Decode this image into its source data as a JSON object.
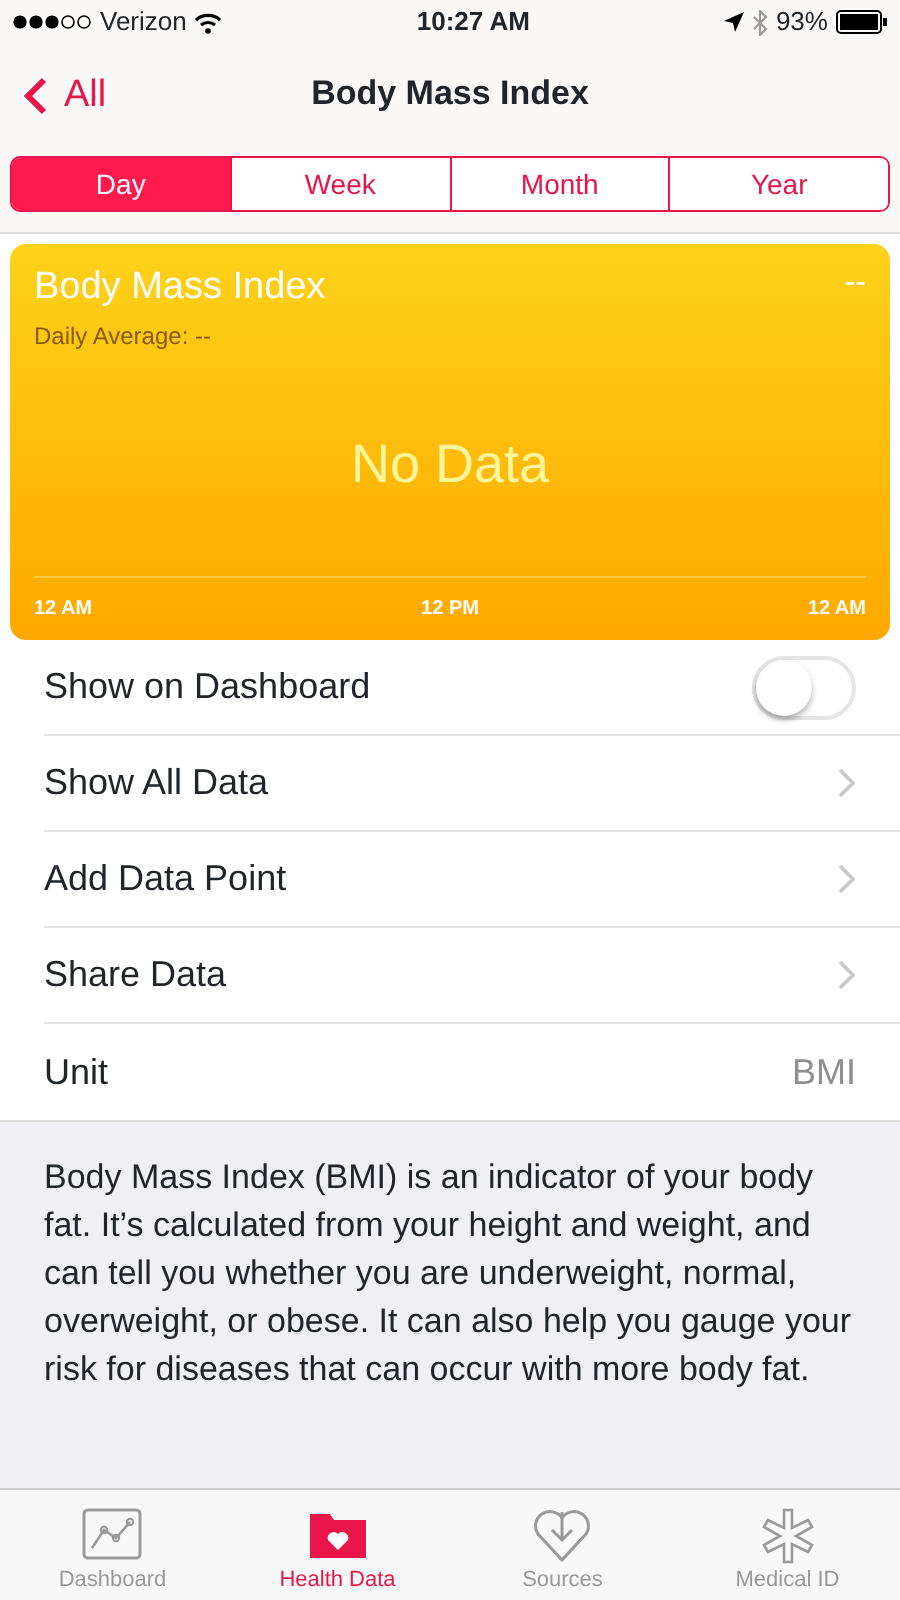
{
  "status_bar": {
    "carrier": "Verizon",
    "time": "10:27 AM",
    "battery": "93%"
  },
  "nav": {
    "back": "All",
    "title": "Body Mass Index"
  },
  "segments": [
    {
      "label": "Day",
      "selected": true
    },
    {
      "label": "Week",
      "selected": false
    },
    {
      "label": "Month",
      "selected": false
    },
    {
      "label": "Year",
      "selected": false
    }
  ],
  "card": {
    "title": "Body Mass Index",
    "value": "--",
    "subtitle": "Daily Average: --",
    "message": "No Data",
    "axis": [
      "12 AM",
      "12 PM",
      "12 AM"
    ]
  },
  "rows": [
    {
      "kind": "toggle",
      "label": "Show on Dashboard",
      "on": false
    },
    {
      "kind": "link",
      "label": "Show All Data"
    },
    {
      "kind": "link",
      "label": "Add Data Point"
    },
    {
      "kind": "link",
      "label": "Share Data"
    },
    {
      "kind": "value",
      "label": "Unit",
      "value": "BMI"
    }
  ],
  "description": "Body Mass Index (BMI) is an indicator of your body fat. It’s calculated from your height and weight, and can tell you whether you are underweight, normal, overweight, or obese. It can also help you gauge your risk for diseases that can occur with more body fat.",
  "tab_bar": [
    {
      "label": "Dashboard",
      "selected": false
    },
    {
      "label": "Health Data",
      "selected": true
    },
    {
      "label": "Sources",
      "selected": false
    },
    {
      "label": "Medical ID",
      "selected": false
    }
  ]
}
